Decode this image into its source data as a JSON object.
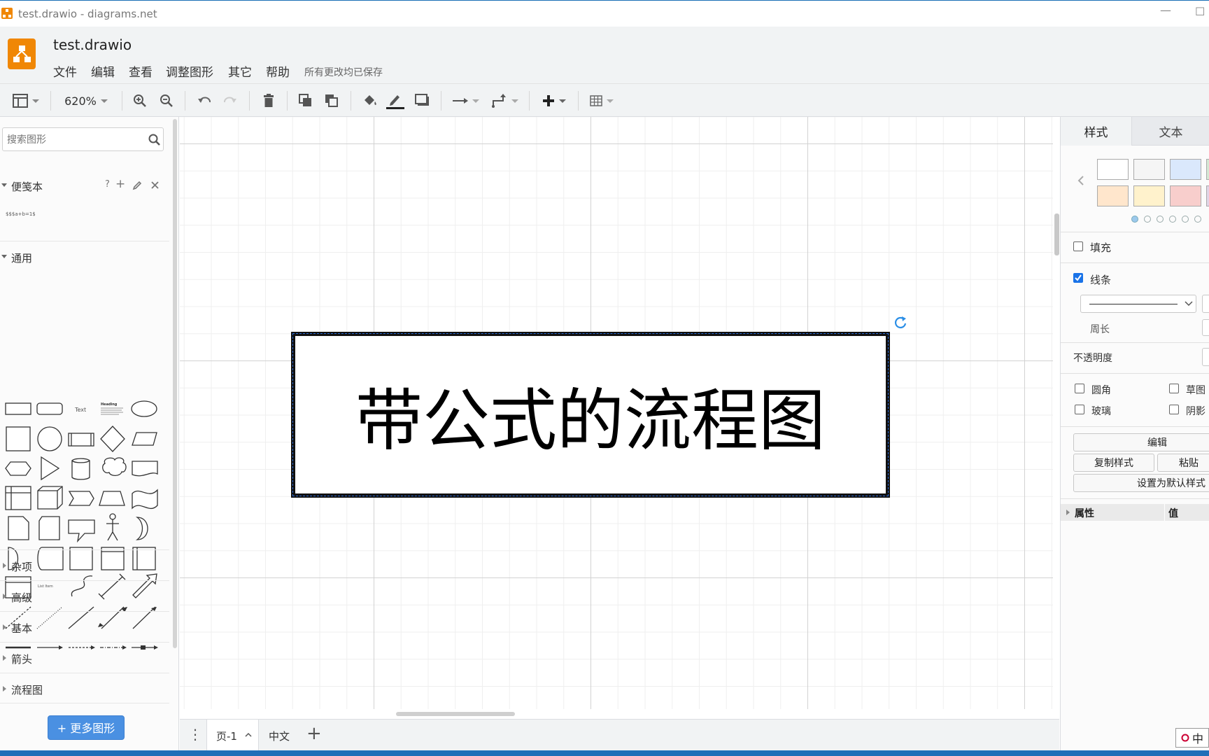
{
  "window": {
    "title": "test.drawio - diagrams.net",
    "minimize_glyph": "—",
    "restore_glyph": "☐"
  },
  "header": {
    "doc_title": "test.drawio",
    "menus": [
      "文件",
      "编辑",
      "查看",
      "调整图形",
      "其它",
      "帮助"
    ],
    "saved_status": "所有更改均已保存"
  },
  "toolbar": {
    "zoom": "620%"
  },
  "left_panel": {
    "search_placeholder": "搜索图形",
    "scratchpad": {
      "label": "便笺本",
      "help": "?",
      "add": "+",
      "item_text": "$$$a+b=1$"
    },
    "general": {
      "label": "通用",
      "text_shape": "Text",
      "heading_shape": "Heading",
      "list_item": "List Item"
    },
    "sections": [
      "杂项",
      "高级",
      "基本",
      "箭头",
      "流程图"
    ],
    "more_shapes": "+ 更多图形"
  },
  "canvas": {
    "box_text": "带公式的流程图"
  },
  "page_bar": {
    "menu_glyph": "⋮",
    "tabs": [
      "页-1",
      "中文"
    ],
    "add_glyph": "+"
  },
  "right_panel": {
    "tabs": [
      "样式",
      "文本"
    ],
    "fill": "填充",
    "line": "线条",
    "perimeter": "周长",
    "opacity": "不透明度",
    "rounded": "圆角",
    "sketch": "草图",
    "glass": "玻璃",
    "shadow": "阴影",
    "edit_btn": "编辑",
    "copy_style_btn": "复制样式",
    "paste_style_btn": "粘贴",
    "set_default_btn": "设置为默认样式",
    "property_header": "属性",
    "value_header": "值",
    "fill_checked": false,
    "line_checked": true,
    "swatches": [
      "#ffffff",
      "#f5f5f5",
      "#dae8fc",
      "#d5e8d4",
      "#ffe6cc",
      "#fff2cc",
      "#f8cecc",
      "#e1d5e7"
    ]
  },
  "ime": {
    "label": "中"
  }
}
